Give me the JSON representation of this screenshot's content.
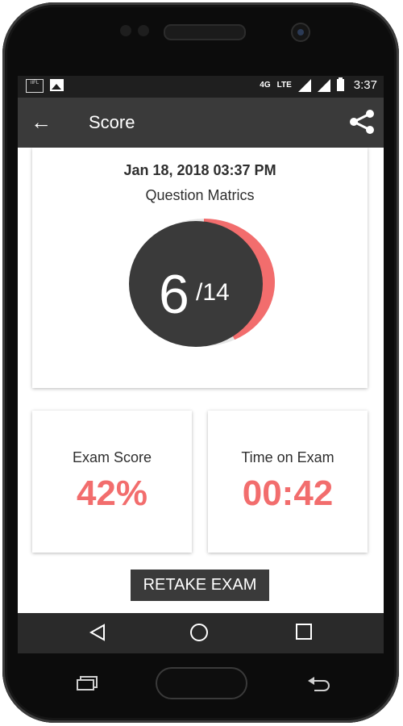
{
  "status_bar": {
    "network": "4G",
    "lte": "LTE",
    "time": "3:37"
  },
  "app_bar": {
    "title": "Score",
    "back_icon": "arrow-left-icon",
    "share_icon": "share-icon"
  },
  "score_card": {
    "date": "Jan 18, 2018 03:37 PM",
    "label": "Question Matrics",
    "correct": "6",
    "total": "/14",
    "progress_fraction": 0.4286
  },
  "stats": {
    "exam_score_label": "Exam Score",
    "exam_score_value": "42%",
    "time_label": "Time on Exam",
    "time_value": "00:42"
  },
  "actions": {
    "retake_label": "RETAKE EXAM"
  },
  "colors": {
    "accent": "#f26d6d",
    "app_bar": "#3a3a3a",
    "dark_circle": "#3a3a3a"
  }
}
